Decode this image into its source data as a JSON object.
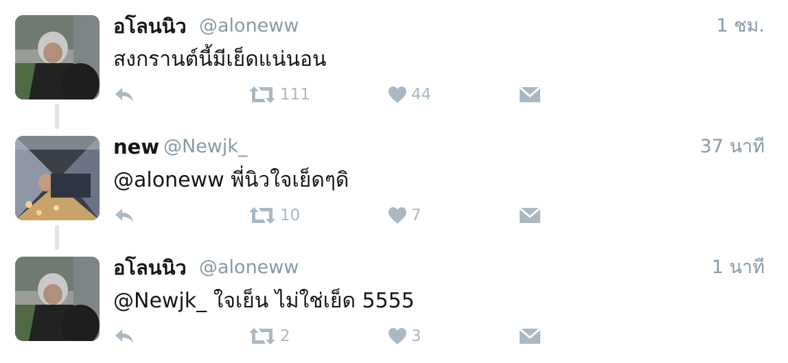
{
  "tweets": [
    {
      "name": "อโลนนิว",
      "handle": "@aloneww",
      "time": "1 ชม.",
      "text": "สงกรานต์นี้มีเย็ดแน่นอน",
      "retweets": "111",
      "likes": "44",
      "avatar": "person-with-backpack-photo"
    },
    {
      "name": "new",
      "handle": "@Newjk_",
      "time": "37 นาที",
      "text": "@aloneww พี่นิวใจเย็ดๆดิ",
      "retweets": "10",
      "likes": "7",
      "avatar": "person-night-lights-photo"
    },
    {
      "name": "อโลนนิว",
      "handle": "@aloneww",
      "time": "1 นาที",
      "text": "@Newjk_ ใจเย็น ไม่ใช่เย็ด 5555",
      "retweets": "2",
      "likes": "3",
      "avatar": "person-with-backpack-photo"
    }
  ],
  "icons": {
    "reply": "reply-icon",
    "retweet": "retweet-icon",
    "like": "heart-icon",
    "dm": "envelope-icon"
  },
  "colors": {
    "text": "#14171a",
    "muted": "#8899a6",
    "icon": "#aab8c2",
    "thread_line": "#dde4ea"
  }
}
